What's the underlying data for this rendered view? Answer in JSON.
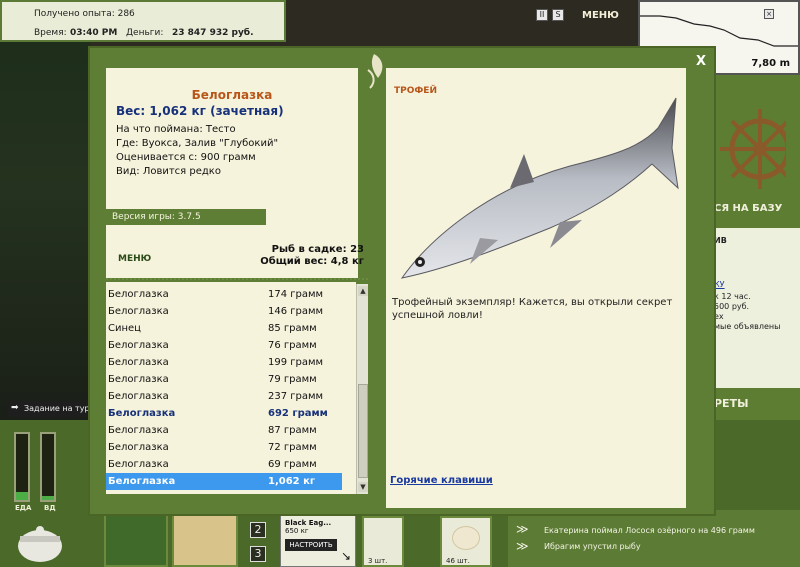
{
  "top_info": {
    "exp": "Получено опыта: 286",
    "time_label": "Время:",
    "time": "03:40 PM",
    "money_label": "Деньги:",
    "money": "23 847 932 руб."
  },
  "top_buttons": {
    "pause": "II",
    "sound": "S",
    "menu": "МЕНЮ"
  },
  "depth": {
    "value": "7,80 m"
  },
  "dialog": {
    "close": "X",
    "fish": {
      "name": "Белоглазка",
      "weight": "Вес: 1,062 кг (зачетная)",
      "caught_on": "На что поймана: Тесто",
      "where": "Где: Вуокса, Залив \"Глубокий\"",
      "valued_from": "Оценивается с: 900 грамм",
      "kind": "Вид: Ловится редко"
    },
    "version": "Версия игры: 3.7.5",
    "menu": "МЕНЮ",
    "keep_count": "Рыб в садке: 23",
    "total_weight": "Общий вес: 4,8 кг",
    "catch_list": [
      {
        "name": "Белоглазка",
        "weight": "174 грамм"
      },
      {
        "name": "Белоглазка",
        "weight": "146 грамм"
      },
      {
        "name": "Синец",
        "weight": "85 грамм"
      },
      {
        "name": "Белоглазка",
        "weight": "76 грамм"
      },
      {
        "name": "Белоглазка",
        "weight": "199 грамм"
      },
      {
        "name": "Белоглазка",
        "weight": "79 грамм"
      },
      {
        "name": "Белоглазка",
        "weight": "237 грамм"
      },
      {
        "name": "Белоглазка",
        "weight": "692 грамм"
      },
      {
        "name": "Белоглазка",
        "weight": "87 грамм"
      },
      {
        "name": "Белоглазка",
        "weight": "72 грамм"
      },
      {
        "name": "Белоглазка",
        "weight": "69 грамм"
      },
      {
        "name": "Белоглазка",
        "weight": "1,062 кг"
      }
    ],
    "trophy": "ТРОФЕЙ",
    "trophy_text": "Трофейный экземпляр! Кажется, вы открыли секрет успешной ловли!",
    "hotkeys": "Горячие клавиши"
  },
  "right_side": {
    "base_btn": "СЯ НА БАЗУ",
    "header": "ИВ",
    "link": "КУ",
    "l1": "к 12 час.",
    "l2": "500 руб.",
    "l3": "ех",
    "l4": "мые объявлены",
    "secrets": "РЕТЫ"
  },
  "meters": {
    "food": "ЕДА",
    "vodka": "ВД",
    "food_level": 0.12,
    "vodka_level": 0.06
  },
  "task": "Задание на тур",
  "slots": {
    "n2": "2",
    "n3": "3"
  },
  "rod": {
    "name": "Black Eag...",
    "weight": "650 кг",
    "setup": "НАСТРОИТЬ"
  },
  "bait_counts": {
    "c1": "3 шт.",
    "c2": "46 шт."
  },
  "messages": [
    "Екатерина поймал Лосося озёрного на 496 грамм",
    "Ибрагим упустил рыбу"
  ]
}
